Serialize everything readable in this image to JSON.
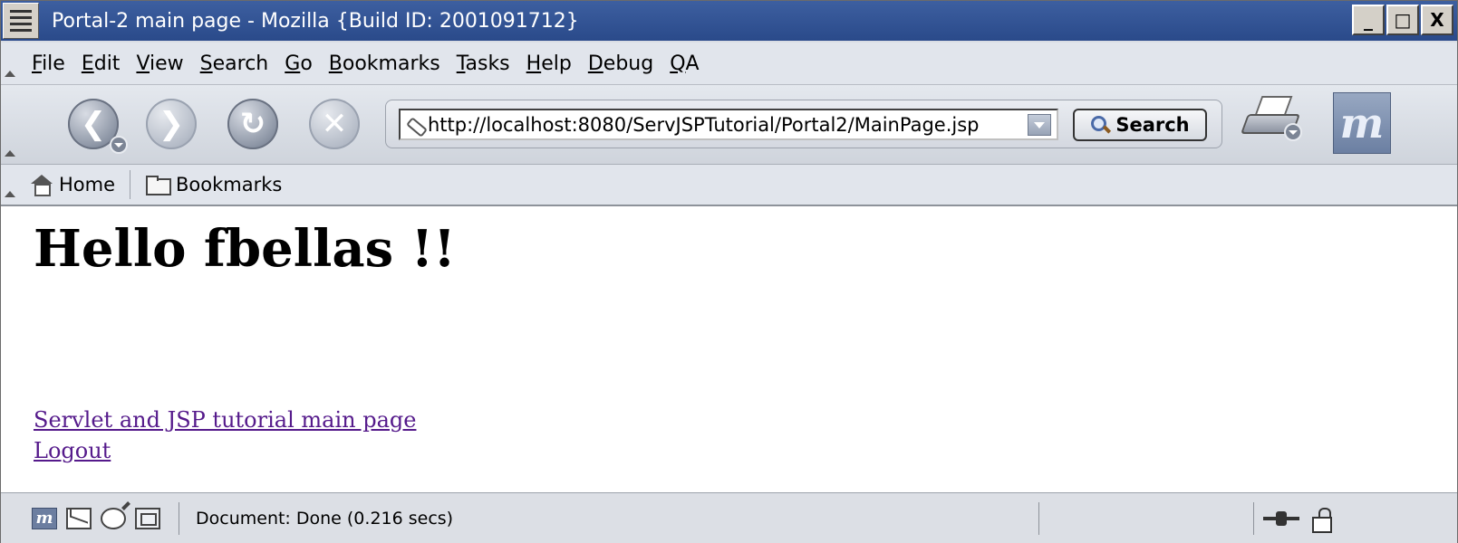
{
  "window": {
    "title": "Portal-2 main page - Mozilla {Build ID: 2001091712}",
    "controls": [
      "_",
      "□",
      "X"
    ]
  },
  "menubar": {
    "items": [
      {
        "accel": "F",
        "rest": "ile"
      },
      {
        "accel": "E",
        "rest": "dit"
      },
      {
        "accel": "V",
        "rest": "iew"
      },
      {
        "accel": "S",
        "rest": "earch"
      },
      {
        "accel": "G",
        "rest": "o"
      },
      {
        "accel": "B",
        "rest": "ookmarks"
      },
      {
        "accel": "T",
        "rest": "asks"
      },
      {
        "accel": "H",
        "rest": "elp"
      },
      {
        "accel": "D",
        "rest": "ebug"
      },
      {
        "accel": "Q",
        "rest": "A"
      }
    ]
  },
  "navbar": {
    "back_icon": "arrow-left",
    "forward_icon": "arrow-right",
    "reload_icon": "reload",
    "stop_icon": "x",
    "url": "http://localhost:8080/ServJSPTutorial/Portal2/MainPage.jsp",
    "search_label": "Search",
    "logo": "m"
  },
  "personal_toolbar": {
    "home_label": "Home",
    "bookmarks_label": "Bookmarks"
  },
  "content": {
    "heading": "Hello fbellas !!",
    "links": [
      "Servlet and JSP tutorial main page",
      "Logout"
    ],
    "link_color": "#551a8b"
  },
  "statusbar": {
    "text": "Document: Done (0.216 secs)",
    "icons": [
      "mozilla-icon",
      "mail-icon",
      "chat-icon",
      "composer-icon",
      "online-icon",
      "lock-icon"
    ]
  },
  "colors": {
    "titlebar": "#2f5196",
    "chrome": "#e1e5ec"
  }
}
